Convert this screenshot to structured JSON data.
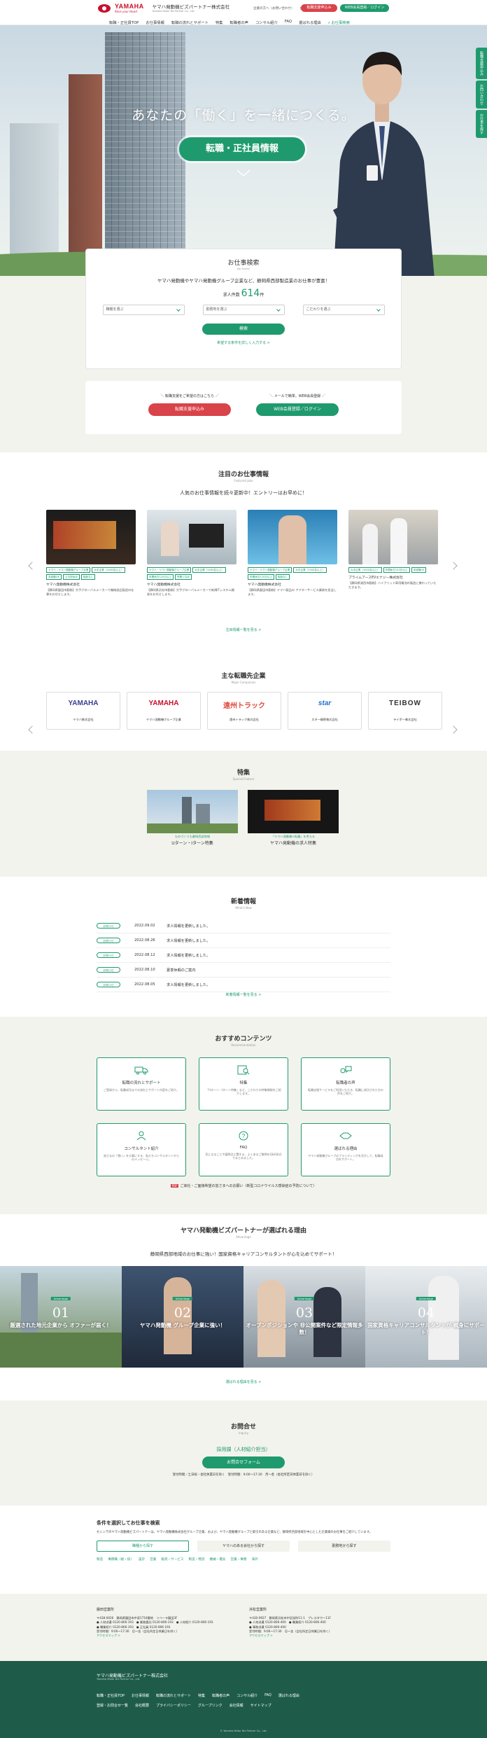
{
  "header": {
    "logo_text": "YAMAHA",
    "logo_sub": "Revs your Heart",
    "company_name": "ヤマハ発動機ビズパートナー株式会社",
    "company_sub": "Yamaha Motor Biz Partner Co., Ltd.",
    "top_links": [
      "企業の方へ（お問い合わせ）",
      "会社概要",
      "お問合せ"
    ],
    "entry_button": "転職支援申込み",
    "web_member_button": "WEB会員登録／ログイン",
    "nav": [
      "転職・正社員TOP",
      "お仕事情報",
      "転職の流れとサポート",
      "特集",
      "転職者の声",
      "コンサル紹介",
      "FAQ",
      "選ばれる理由"
    ],
    "nav_search": "お仕事検索"
  },
  "side_tabs": [
    "転職支援申込み",
    "お問い合わせ",
    "お仕事を探す"
  ],
  "hero": {
    "copy": "あなたの「働く」を一緒につくる。",
    "badge": "転職・正社員情報"
  },
  "search": {
    "title": "お仕事検索",
    "subtitle": "Job Search",
    "lead": "ヤマハ発動機やヤマハ発動機グループ企業など、静岡県西部製造業のお仕事が豊富！",
    "count_prefix": "求人件数",
    "count": "614",
    "count_suffix": "件",
    "selects": [
      "職種を選ぶ",
      "勤務地を選ぶ",
      "こだわりを選ぶ"
    ],
    "button": "検索",
    "more_link": "希望する条件を詳しく入力する >"
  },
  "entry": {
    "left_caption": "＼ 転職支援をご希望の方はこちら ／",
    "right_caption": "＼ メールで簡単。WEB会員登録 ／",
    "left_button": "転職支援申込み",
    "right_button": "WEB会員登録／ログイン"
  },
  "featured": {
    "title": "注目のお仕事情報",
    "subtitle": "Featured Jobs",
    "lead": "人気のお仕事情報を続々更新中！エントリーはお早めに！",
    "more": "注目情報一覧を見る >",
    "cards": [
      {
        "tags": [
          "ヤマハ・ヤマハ発動機グループ企業",
          "大手企業（1000名以上）",
          "未経験OK",
          "土日祝休み",
          "転勤なし"
        ],
        "company": "ヤマハ発動機株式会社",
        "desc": "【静岡県磐田市勤務】大手グローバルメーカーで機械部品製造の仕事をお任せします。"
      },
      {
        "tags": [
          "ヤマハ・ヤマハ発動機グループ企業",
          "大手企業（1000名以上）",
          "年間休日120日以上",
          "残業少なめ"
        ],
        "company": "ヤマハ発動機株式会社",
        "desc": "【静岡県浜松市勤務】大手グローバルメーカーで新規ITシステム開発をお任せします。"
      },
      {
        "tags": [
          "ヤマハ・ヤマハ発動機グループ企業",
          "大手企業（1000名以上）",
          "年間休日120日以上",
          "転勤なし"
        ],
        "company": "ヤマハ発動機株式会社",
        "desc": "【静岡県磐田市勤務】ヤマハ製品の アフターサービス業務を担当します。"
      },
      {
        "tags": [
          "大手企業（1000名以上）",
          "年間休日120日以上",
          "未経験OK"
        ],
        "company": "プライムアースEVエナジー株式会社",
        "desc": "【静岡県湖西市勤務】ハイブリッド車用電池の製造に携わっていただきます。"
      }
    ]
  },
  "companies": {
    "title": "主な転職先企業",
    "subtitle": "Major Companies",
    "items": [
      {
        "mark": "YAMAHA",
        "name": "ヤマハ株式会社",
        "color": "#3a3f8f"
      },
      {
        "mark": "YAMAHA",
        "name": "ヤマハ発動機グループ企業",
        "color": "#c8102e"
      },
      {
        "mark": "遠州トラック",
        "name": "遠州トラック株式会社",
        "color": "#e04a3a"
      },
      {
        "mark": "star",
        "name": "スター精密株式会社",
        "color": "#1f6fd0"
      },
      {
        "mark": "TEIBOW",
        "name": "テイボー株式会社",
        "color": "#333333"
      }
    ]
  },
  "special": {
    "title": "特集",
    "subtitle": "Special Feature",
    "items": [
      {
        "caption": "ものづくりも静岡西部地域",
        "title": "Uターン・Iターン特集"
      },
      {
        "caption": "「ヤマハ発動機×転職」を考える",
        "title": "ヤマハ発動機の求人特集"
      }
    ]
  },
  "news": {
    "title": "新着情報",
    "subtitle": "What's New",
    "more": "新着情報一覧を見る >",
    "items": [
      {
        "badge": "お知らせ",
        "date": "2022.09.02",
        "text": "求人情報を更新しました。"
      },
      {
        "badge": "お知らせ",
        "date": "2022.08.26",
        "text": "求人情報を更新しました。"
      },
      {
        "badge": "お知らせ",
        "date": "2022.08.12",
        "text": "求人情報を更新しました。"
      },
      {
        "badge": "お知らせ",
        "date": "2022.08.10",
        "text": "夏季休暇のご案内"
      },
      {
        "badge": "お知らせ",
        "date": "2022.08.05",
        "text": "求人情報を更新しました。"
      }
    ]
  },
  "recommend": {
    "title": "おすすめコンテンツ",
    "subtitle": "Recommendation",
    "items": [
      {
        "title": "転職の流れとサポート",
        "desc": "ご登録から、転職成功までの流れとサポート内容をご紹介。"
      },
      {
        "title": "特集",
        "desc": "「Uターン・Iターン特集」など、こだわりの特集情報をご紹介します。"
      },
      {
        "title": "転職者の声",
        "desc": "転職支援サービスをご利用いただき、転職に成功された方の声をご紹介。"
      },
      {
        "title": "コンサルタント紹介",
        "desc": "皆さまの「想い」を大事にする、私たちコンサルタントからのメッセージ。"
      },
      {
        "title": "FAQ",
        "desc": "気になることや疑問点に関する、よくあるご質問をQ&A形式でまとめました。"
      },
      {
        "title": "選ばれる理由",
        "desc": "ヤマハ発動機グループのブランディングを活かして、転職成功をサポート。"
      }
    ],
    "covid_badge": "PDF",
    "covid": "ご来社・ご面接希望の皆さまへのお願い（新型コロナウイルス感染症の予防について）"
  },
  "reasons": {
    "title": "ヤマハ発動機ビズパートナーが選ばれる理由",
    "subtitle": "Advantage",
    "lead": "静岡県西部地域のお仕事に強い！国家資格キャリアコンサルタントが心を込めてサポート！",
    "more": "選ばれる理由を見る >",
    "items": [
      {
        "badge": "Advantage",
        "num": "01",
        "title": "厳選された地元企業から オファーが届く！"
      },
      {
        "badge": "Advantage",
        "num": "02",
        "title": "ヤマハ発動機 グループ企業に強い！"
      },
      {
        "badge": "Advantage",
        "num": "03",
        "title": "オープンポジションや 非公開案件など限定情報多数！"
      },
      {
        "badge": "Advantage",
        "num": "04",
        "title": "国家資格キャリアコンサルタントが 親身にサポート！"
      }
    ]
  },
  "inquiry": {
    "title": "お問合せ",
    "subtitle": "Inquiry",
    "dept": "採用課（人材紹介担当）",
    "button": "お問合せフォーム",
    "info": "受付時間／土日祝・会社休業日を除く　受付時間：9:00〜17:30　月〜金（会社所定日休業日を除く）"
  },
  "conditions": {
    "title": "条件を選択してお仕事を検索",
    "desc": "セニン下のヤマハ発動機ビズパートナーは、ヤマハ発動機株式会社グループ企業、および、ヤマハ発動機グループと取引のある企業など、静岡県西部地域を中心とした企業様のお仕事をご紹介しています。",
    "buttons": [
      "職種から探す",
      "ヤマハのある会社から探す",
      "勤務地から探す"
    ],
    "links": [
      "製造",
      "事務職（総・技）",
      "設計",
      "営業",
      "販売・サービス",
      "製造・物流",
      "機械・電気",
      "営業・事務",
      "海外"
    ]
  },
  "offices": [
    {
      "title": "磐田営業所",
      "lines": [
        "〒438-0026　静岡県磐田市中泉1718番地　リベーラ磐田3F",
        "● 人材派遣 0120-806-193　● 業務委託 0120-806-193　● 人材紹介 0120-806-193",
        "● 職業紹介 0120-806-193　● 正社員 0120-806-193",
        "受付時間：9:00〜17:30　月〜金（会社所定日休業日を除く）"
      ],
      "link": "アクセスマップ >"
    },
    {
      "title": "浜松営業所",
      "lines": [
        "〒430-0927　静岡県浜松市中区旭町11-1　プレスタワー11F",
        "● 人材派遣 0120-806-400　● 職業紹介 0120-806-400",
        "● 事務派遣 0120-806-400",
        "受付時間：9:00〜17:30　月〜金（会社所定日休業日を除く）"
      ],
      "link": "アクセスマップ >"
    }
  ],
  "footer": {
    "name": "ヤマハ発動機ビズパートナー株式会社",
    "sub": "Yamaha Motor Biz Partner Co., Ltd.",
    "links1": [
      "転職・正社員TOP",
      "お仕事情報",
      "転職の流れとサポート",
      "特集",
      "転職者の声",
      "コンサル紹介",
      "FAQ",
      "選ばれる理由"
    ],
    "links2": [
      "登録・お問合せ一覧",
      "会社概要",
      "プライバシーポリシー",
      "グループリンク",
      "会社情報",
      "サイトマップ"
    ],
    "copyright": "© Yamaha Motor Biz Partner Co., Ltd."
  },
  "colors": {
    "accent": "#1f9a6e",
    "entry": "#d9434a",
    "footer": "#1e5c49",
    "section_bg": "#f2f3ec"
  }
}
